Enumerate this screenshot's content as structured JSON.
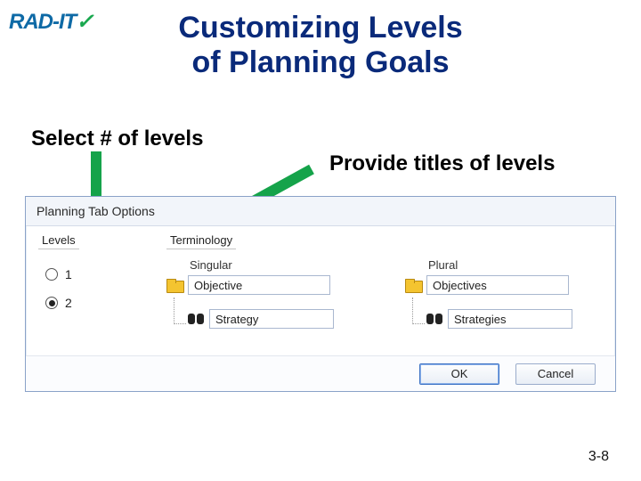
{
  "logo": {
    "main": "RAD-IT",
    "accent": "✓"
  },
  "slide": {
    "title_line1": "Customizing Levels",
    "title_line2": "of Planning Goals",
    "page_number": "3-8"
  },
  "annotations": {
    "select_levels": "Select # of levels",
    "provide_titles": "Provide titles of levels"
  },
  "colors": {
    "arrow": "#15a34a",
    "title": "#0a2a7a"
  },
  "dialog": {
    "header": "Planning Tab Options",
    "sections": {
      "levels_label": "Levels",
      "terminology_label": "Terminology",
      "singular_label": "Singular",
      "plural_label": "Plural"
    },
    "levels": {
      "option1": "1",
      "option2": "2",
      "selected": "2"
    },
    "fields": {
      "singular_level1": "Objective",
      "singular_level2": "Strategy",
      "plural_level1": "Objectives",
      "plural_level2": "Strategies"
    },
    "buttons": {
      "ok": "OK",
      "cancel": "Cancel"
    }
  }
}
